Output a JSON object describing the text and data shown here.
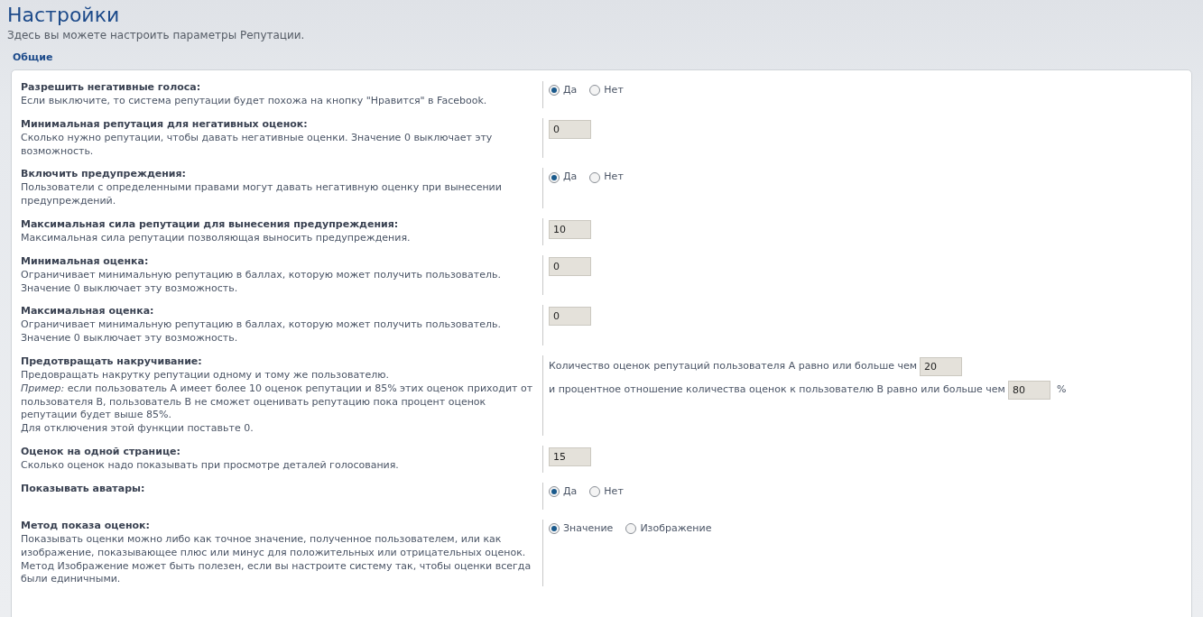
{
  "page": {
    "title": "Настройки",
    "subtitle": "Здесь вы можете настроить параметры Репутации."
  },
  "section": {
    "title": "Общие"
  },
  "settings": [
    {
      "title": "Разрешить негативные голоса:",
      "description": [
        "Если выключите, то система репутации будет похожа на кнопку \"Нравится\" в Facebook."
      ],
      "control": {
        "kind": "radio",
        "options": [
          {
            "label": "Да",
            "selected": true
          },
          {
            "label": "Нет",
            "selected": false
          }
        ]
      }
    },
    {
      "title": "Минимальная репутация для негативных оценок:",
      "description": [
        "Сколько нужно репутации, чтобы давать негативные оценки. Значение 0 выключает эту возможность."
      ],
      "control": {
        "kind": "input",
        "value": "0"
      }
    },
    {
      "title": "Включить предупреждения:",
      "description": [
        "Пользователи с определенными правами могут давать негативную оценку при вынесении предупреждений."
      ],
      "control": {
        "kind": "radio",
        "options": [
          {
            "label": "Да",
            "selected": true
          },
          {
            "label": "Нет",
            "selected": false
          }
        ]
      }
    },
    {
      "title": "Максимальная сила репутации для вынесения предупреждения:",
      "description": [
        "Максимальная сила репутации позволяющая выносить предупреждения."
      ],
      "control": {
        "kind": "input",
        "value": "10"
      }
    },
    {
      "title": "Минимальная оценка:",
      "description": [
        "Ограничивает минимальную репутацию в баллах, которую может получить пользователь.",
        "Значение 0 выключает эту возможность."
      ],
      "control": {
        "kind": "input",
        "value": "0"
      }
    },
    {
      "title": "Максимальная оценка:",
      "description": [
        "Ограничивает минимальную репутацию в баллах, которую может получить пользователь.",
        "Значение 0 выключает эту возможность."
      ],
      "control": {
        "kind": "input",
        "value": "0"
      }
    },
    {
      "title": "Предотвращать накручивание:",
      "description": [
        "Предовращать накрутку репутации одному и тому же пользователю.",
        "*Пример:* если пользователь А имеет более 10 оценок репутации и 85% этих оценок приходит от пользователя В, пользователь В не сможет оценивать репутацию пока процент оценок репутации будет выше 85%.",
        "Для отключения этой функции поставьте 0."
      ],
      "control": {
        "kind": "compound",
        "lines": [
          {
            "text": "Количество оценок репутаций пользователя А равно или больше чем",
            "value": "20"
          },
          {
            "text": "и процентное отношение количества оценок к пользователю В равно или больше чем",
            "value": "80",
            "suffix": "%"
          }
        ]
      }
    },
    {
      "title": "Оценок на одной странице:",
      "description": [
        "Сколько оценок надо показывать при просмотре деталей голосования."
      ],
      "control": {
        "kind": "input",
        "value": "15"
      }
    },
    {
      "title": "Показывать аватары:",
      "control": {
        "kind": "radio",
        "options": [
          {
            "label": "Да",
            "selected": true
          },
          {
            "label": "Нет",
            "selected": false
          }
        ]
      }
    },
    {
      "title": "Метод показа оценок:",
      "description": [
        "Показывать оценки можно либо как точное значение, полученное пользователем, или как изображение, показывающее плюс или минус для положительных или отрицательных оценок. Метод Изображение может быть полезен, если вы настроите систему так, чтобы оценки всегда были единичными."
      ],
      "control": {
        "kind": "radio",
        "options": [
          {
            "label": "Значение",
            "selected": true
          },
          {
            "label": "Изображение",
            "selected": false
          }
        ]
      }
    }
  ]
}
